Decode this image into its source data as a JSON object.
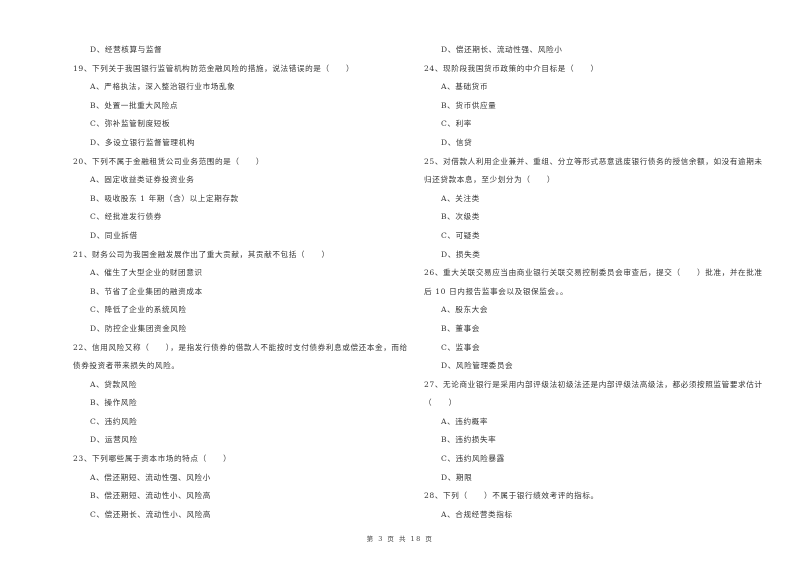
{
  "left_column": [
    {
      "type": "opt",
      "text": "D、经营核算与监督"
    },
    {
      "type": "q",
      "text": "19、下列关于我国银行监管机构防范金融风险的措施，说法错误的是（　　）"
    },
    {
      "type": "opt",
      "text": "A、严格执法，深入整治银行业市场乱象"
    },
    {
      "type": "opt",
      "text": "B、处置一批重大风险点"
    },
    {
      "type": "opt",
      "text": "C、弥补监管制度短板"
    },
    {
      "type": "opt",
      "text": "D、多设立银行监督管理机构"
    },
    {
      "type": "q",
      "text": "20、下列不属于金融租赁公司业务范围的是（　　）"
    },
    {
      "type": "opt",
      "text": "A、固定收益类证券投资业务"
    },
    {
      "type": "opt",
      "text": "B、吸收股东 1 年期（含）以上定期存款"
    },
    {
      "type": "opt",
      "text": "C、经批准发行债券"
    },
    {
      "type": "opt",
      "text": "D、同业拆借"
    },
    {
      "type": "q",
      "text": "21、财务公司为我国金融发展作出了重大贡献，其贡献不包括（　　）"
    },
    {
      "type": "opt",
      "text": "A、催生了大型企业的财团意识"
    },
    {
      "type": "opt",
      "text": "B、节省了企业集团的融资成本"
    },
    {
      "type": "opt",
      "text": "C、降低了企业的系统风险"
    },
    {
      "type": "opt",
      "text": "D、防控企业集团资金风险"
    },
    {
      "type": "q",
      "text": "22、信用风险又称（　　），是指发行债券的借款人不能按时支付债券利息或偿还本金，而给"
    },
    {
      "type": "cont",
      "text": "债券投资者带来损失的风险。"
    },
    {
      "type": "opt",
      "text": "A、贷款风险"
    },
    {
      "type": "opt",
      "text": "B、操作风险"
    },
    {
      "type": "opt",
      "text": "C、违约风险"
    },
    {
      "type": "opt",
      "text": "D、运营风险"
    },
    {
      "type": "q",
      "text": "23、下列哪些属于资本市场的特点（　　）"
    },
    {
      "type": "opt",
      "text": "A、偿还期短、流动性强、风险小"
    },
    {
      "type": "opt",
      "text": "B、偿还期短、流动性小、风险高"
    },
    {
      "type": "opt",
      "text": "C、偿还期长、流动性小、风险高"
    }
  ],
  "right_column": [
    {
      "type": "opt",
      "text": "D、偿还期长、流动性强、风险小"
    },
    {
      "type": "q",
      "text": "24、现阶段我国货币政策的中介目标是（　　）"
    },
    {
      "type": "opt",
      "text": "A、基础货币"
    },
    {
      "type": "opt",
      "text": "B、货币供应量"
    },
    {
      "type": "opt",
      "text": "C、利率"
    },
    {
      "type": "opt",
      "text": "D、信贷"
    },
    {
      "type": "q",
      "text": "25、对借款人利用企业兼并、重组、分立等形式恶意逃废银行债务的授信余额，如没有逾期未"
    },
    {
      "type": "cont",
      "text": "归还贷款本息，至少划分为（　　）"
    },
    {
      "type": "opt",
      "text": "A、关注类"
    },
    {
      "type": "opt",
      "text": "B、次级类"
    },
    {
      "type": "opt",
      "text": "C、可疑类"
    },
    {
      "type": "opt",
      "text": "D、损失类"
    },
    {
      "type": "q",
      "text": "26、重大关联交易应当由商业银行关联交易控制委员会审查后，提交（　　）批准，并在批准"
    },
    {
      "type": "cont",
      "text": "后 10 日内报告监事会以及银保监会。。"
    },
    {
      "type": "opt",
      "text": "A、股东大会"
    },
    {
      "type": "opt",
      "text": "B、董事会"
    },
    {
      "type": "opt",
      "text": "C、监事会"
    },
    {
      "type": "opt",
      "text": "D、风险管理委员会"
    },
    {
      "type": "q",
      "text": "27、无论商业银行是采用内部评级法初级法还是内部评级法高级法，都必须按照监管要求估计"
    },
    {
      "type": "cont",
      "text": "（　　）"
    },
    {
      "type": "opt",
      "text": "A、违约概率"
    },
    {
      "type": "opt",
      "text": "B、违约损失率"
    },
    {
      "type": "opt",
      "text": "C、违约风险暴露"
    },
    {
      "type": "opt",
      "text": "D、期限"
    },
    {
      "type": "q",
      "text": "28、下列（　　）不属于银行绩效考评的指标。"
    },
    {
      "type": "opt",
      "text": "A、合规经营类指标"
    }
  ],
  "footer": {
    "page_label": "第 3 页 共 18 页"
  }
}
